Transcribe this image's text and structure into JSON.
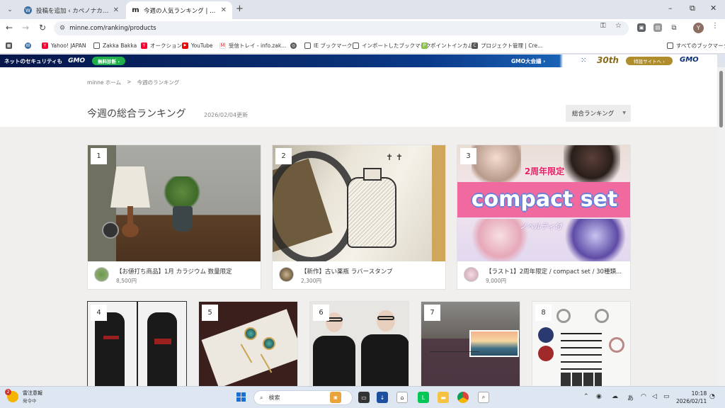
{
  "browser": {
    "tabs": [
      {
        "title": "投稿を追加 ‹ カペノナカ — WordPress",
        "icon": "wordpress-icon",
        "active": false
      },
      {
        "title": "今週の人気ランキング | minne 国内最大級",
        "icon": "minne-icon",
        "active": true
      }
    ],
    "new_tab": "+",
    "window_controls": {
      "minimize": "–",
      "maximize": "⧉",
      "close": "✕"
    },
    "url": "minne.com/ranking/products",
    "profile_initial": "Y",
    "bookmarks": [
      {
        "label": "",
        "icon": "apps-grid-icon"
      },
      {
        "label": "",
        "icon": "wordpress-icon"
      },
      {
        "label": "Yahoo! JAPAN",
        "icon": "yahoo-icon"
      },
      {
        "label": "Zakka Bakka",
        "icon": "folder-icon"
      },
      {
        "label": "オークション",
        "icon": "yahoo-icon"
      },
      {
        "label": "YouTube",
        "icon": "youtube-icon"
      },
      {
        "label": "受信トレイ - info.zak...",
        "icon": "gmail-icon"
      },
      {
        "label": "",
        "icon": "globe-icon"
      },
      {
        "label": "IE ブックマーク",
        "icon": "folder-icon"
      },
      {
        "label": "インポートしたブックマーク",
        "icon": "folder-icon"
      },
      {
        "label": "ポイントインカム",
        "icon": "pointincome-icon"
      },
      {
        "label": "プロジェクト管理 | Cre...",
        "icon": "c-icon"
      }
    ],
    "all_bookmarks": "すべてのブックマーク"
  },
  "banner": {
    "left_text": "ネットのセキュリティも",
    "logo": "GMO",
    "free_btn": "無料診断 ›",
    "mid_text": "GMO大会議 ›",
    "anniv": "30th",
    "special_btn": "特設サイトへ ›",
    "right_logo": "GMO"
  },
  "page": {
    "breadcrumb": [
      "minne ホーム",
      ">",
      "今週のランキング"
    ],
    "title": "今週の総合ランキング",
    "updated": "2026/02/04更新",
    "sort_label": "総合ランキング",
    "items": [
      {
        "rank": "1",
        "title": "【お値打ち商品】1月 カラジウム 数量限定",
        "price": "8,500円"
      },
      {
        "rank": "2",
        "title": "【新作】古い薬瓶 ラバースタンプ",
        "price": "2,300円"
      },
      {
        "rank": "3",
        "title": "【ラスト1】2周年限定 / compact set / 30種類...",
        "price": "9,000円",
        "banner_top": "2周年限定",
        "banner_main": "compact set",
        "banner_sub": "ノベルティ付"
      },
      {
        "rank": "4"
      },
      {
        "rank": "5"
      },
      {
        "rank": "6"
      },
      {
        "rank": "7"
      },
      {
        "rank": "8"
      }
    ]
  },
  "taskbar": {
    "weather_badge": "2",
    "weather_title": "雷注意報",
    "weather_sub": "発令中",
    "search_placeholder": "検索",
    "ime": "あ",
    "time": "10:18",
    "date": "2026/02/11"
  }
}
